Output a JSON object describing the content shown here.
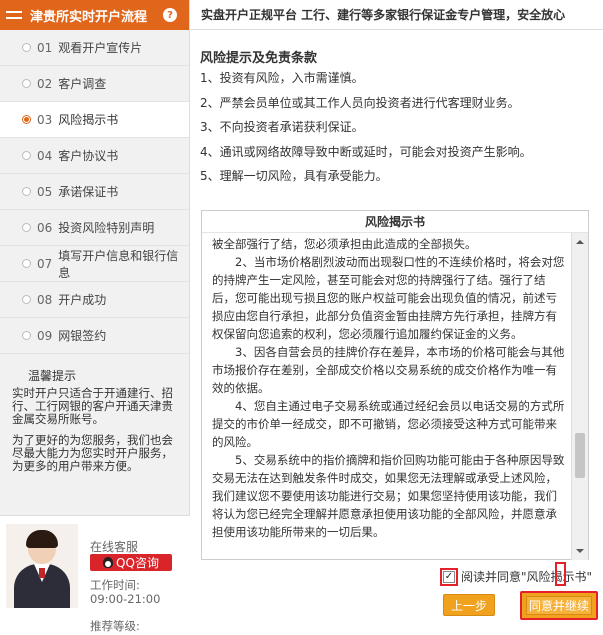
{
  "sidebar": {
    "title": "津贵所实时开户流程",
    "help_glyph": "?",
    "steps": [
      {
        "num": "01",
        "label": "观看开户宣传片",
        "active": false
      },
      {
        "num": "02",
        "label": "客户调查",
        "active": false
      },
      {
        "num": "03",
        "label": "风险揭示书",
        "active": true
      },
      {
        "num": "04",
        "label": "客户协议书",
        "active": false
      },
      {
        "num": "05",
        "label": "承诺保证书",
        "active": false
      },
      {
        "num": "06",
        "label": "投资风险特别声明",
        "active": false
      },
      {
        "num": "07",
        "label": "填写开户信息和银行信息",
        "active": false
      },
      {
        "num": "08",
        "label": "开户成功",
        "active": false
      },
      {
        "num": "09",
        "label": "网银签约",
        "active": false
      }
    ],
    "tips_title": "温馨提示",
    "tips": [
      "实时开户只适合于开通建行、招行、工行网银的客户开通天津贵金属交易所账号。",
      "为了更好的为您服务，我们也会尽最大能力为您实时开户服务，为更多的用户带来方便。"
    ],
    "support": {
      "label": "在线客服",
      "qq_button": "QQ咨询",
      "hours_label": "工作时间:",
      "hours": "09:00-21:00",
      "rating_label": "推荐等级:"
    }
  },
  "main": {
    "banner": "实盘开户正规平台 工行、建行等多家银行保证金专户管理，安全放心",
    "risk_title": "风险提示及免责条款",
    "risk_items": [
      "1、投资有风险，入市需谨慎。",
      "2、严禁会员单位或其工作人员向投资者进行代客理财业务。",
      "3、不向投资者承诺获利保证。",
      "4、通讯或网络故障导致中断或延时，可能会对投资产生影响。",
      "5、理解一切风险，具有承受能力。"
    ],
    "doc_title": "风险揭示书",
    "doc_paragraphs": [
      "被全部强行了结，您必须承担由此造成的全部损失。",
      "　　2、当市场价格剧烈波动而出现裂口性的不连续价格时，将会对您的持牌产生一定风险，甚至可能会对您的持牌强行了结。强行了结后，您可能出现亏损且您的账户权益可能会出现负值的情况，前述亏损应由您自行承担，此部分负值资金暂由挂牌方先行承担，挂牌方有权保留向您追索的权利，您必须履行追加履约保证金的义务。",
      "　　3、因各自营会员的挂牌价存在差异，本市场的价格可能会与其他市场报价存在差别，全部成交价格以交易系统的成交价格作为唯一有效的依据。",
      "　　4、您自主通过电子交易系统或通过经纪会员以电话交易的方式所提交的市价单一经成交，即不可撤销，您必须接受这种方式可能带来的风险。",
      "　　5、交易系统中的指价摘牌和指价回购功能可能由于各种原因导致交易无法在达到触发条件时成交，如果您无法理解或承受上述风险，我们建议您不要使用该功能进行交易；如果您坚持使用该功能，我们将认为您已经完全理解并愿意承担使用该功能的全部风险，并愿意承担使用该功能所带来的一切后果。"
    ],
    "agree_label": "阅读并同意\"风险揭示书\"",
    "agree_checked": true,
    "prev_button": "上一步",
    "next_button": "同意并继续"
  },
  "colors": {
    "accent": "#e0661c",
    "button": "#f0a11e",
    "highlight": "#e4202a",
    "qq": "#d9252a"
  }
}
